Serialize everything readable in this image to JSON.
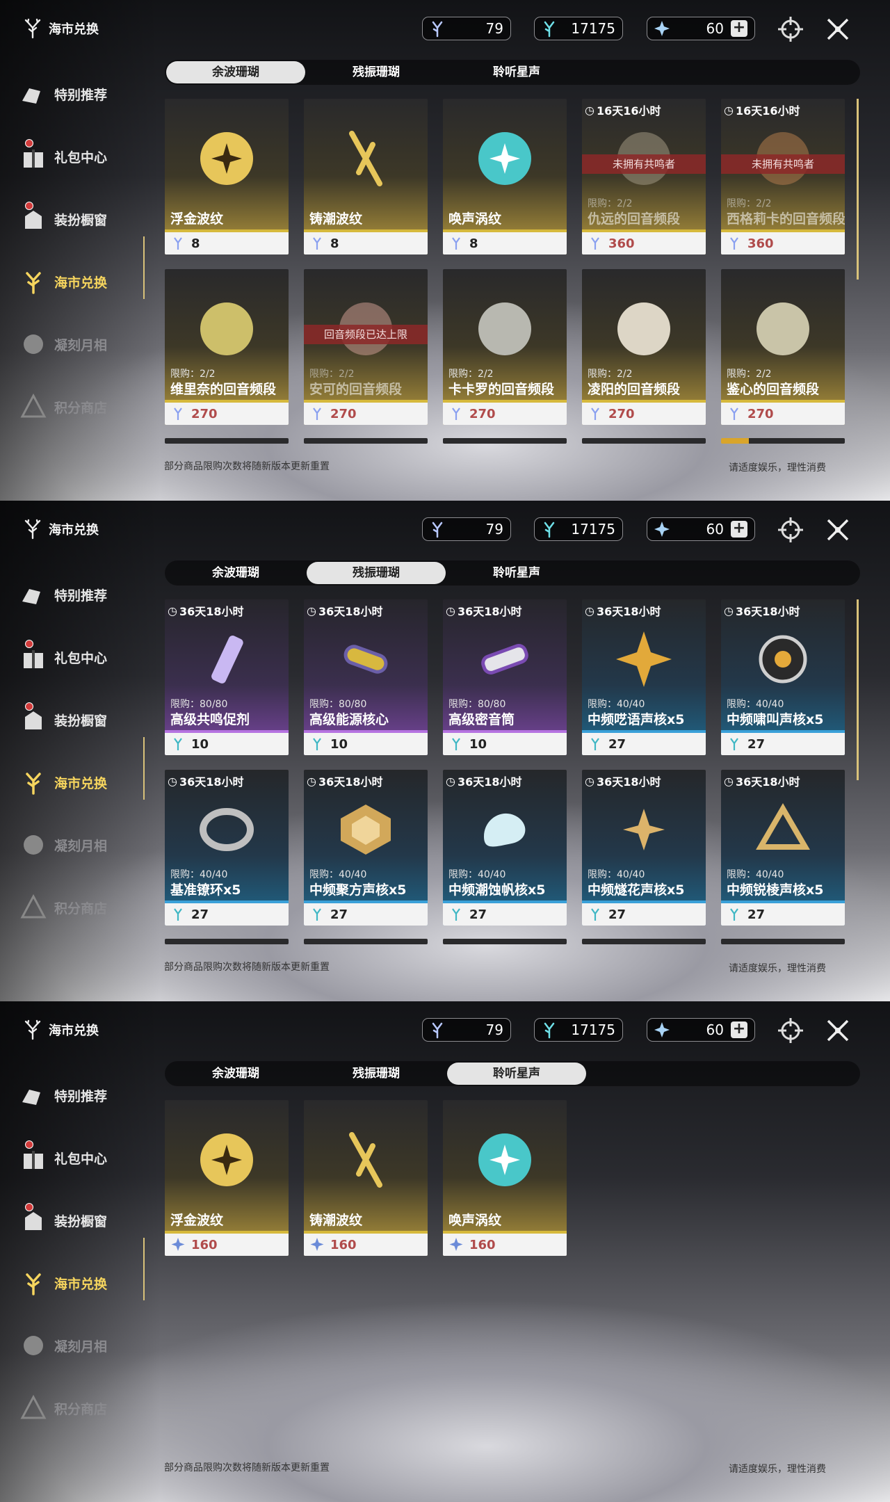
{
  "panels": [
    {
      "header": {
        "title": "海市兑换",
        "res1": "79",
        "res2": "17175",
        "res3": "60"
      },
      "sidebar": [
        {
          "label": "特别推荐"
        },
        {
          "label": "礼包中心"
        },
        {
          "label": "装扮橱窗"
        },
        {
          "label": "海市兑换"
        },
        {
          "label": "凝刻月相"
        },
        {
          "label": "积分商店"
        }
      ],
      "tabs": [
        {
          "label": "余波珊瑚"
        },
        {
          "label": "残振珊瑚"
        },
        {
          "label": "聆听星声"
        }
      ],
      "cards": [
        {
          "name": "浮金波纹",
          "price": "8"
        },
        {
          "name": "铸潮波纹",
          "price": "8"
        },
        {
          "name": "唤声涡纹",
          "price": "8"
        },
        {
          "timer": "16天16小时",
          "banner": "未拥有共鸣者",
          "limit": "限购：2/2",
          "name": "仇远的回音频段",
          "price": "360"
        },
        {
          "timer": "16天16小时",
          "banner": "未拥有共鸣者",
          "limit": "限购：2/2",
          "name": "西格莉卡的回音频段",
          "price": "360"
        },
        {
          "limit": "限购：2/2",
          "name": "维里奈的回音频段",
          "price": "270"
        },
        {
          "banner": "回音频段已达上限",
          "limit": "限购：2/2",
          "name": "安可的回音频段",
          "price": "270"
        },
        {
          "limit": "限购：2/2",
          "name": "卡卡罗的回音频段",
          "price": "270"
        },
        {
          "limit": "限购：2/2",
          "name": "凌阳的回音频段",
          "price": "270"
        },
        {
          "limit": "限购：2/2",
          "name": "鉴心的回音频段",
          "price": "270"
        }
      ],
      "note_left": "部分商品限购次数将随新版本更新重置",
      "note_right": "请适度娱乐，理性消费"
    },
    {
      "header": {
        "title": "海市兑换",
        "res1": "79",
        "res2": "17175",
        "res3": "60"
      },
      "sidebar": [
        {
          "label": "特别推荐"
        },
        {
          "label": "礼包中心"
        },
        {
          "label": "装扮橱窗"
        },
        {
          "label": "海市兑换"
        },
        {
          "label": "凝刻月相"
        },
        {
          "label": "积分商店"
        }
      ],
      "tabs": [
        {
          "label": "余波珊瑚"
        },
        {
          "label": "残振珊瑚"
        },
        {
          "label": "聆听星声"
        }
      ],
      "cards": [
        {
          "timer": "36天18小时",
          "limit": "限购：80/80",
          "name": "高级共鸣促剂",
          "price": "10"
        },
        {
          "timer": "36天18小时",
          "limit": "限购：80/80",
          "name": "高级能源核心",
          "price": "10"
        },
        {
          "timer": "36天18小时",
          "limit": "限购：80/80",
          "name": "高级密音筒",
          "price": "10"
        },
        {
          "timer": "36天18小时",
          "limit": "限购：40/40",
          "name": "中频呓语声核x5",
          "price": "27"
        },
        {
          "timer": "36天18小时",
          "limit": "限购：40/40",
          "name": "中频啸叫声核x5",
          "price": "27"
        },
        {
          "timer": "36天18小时",
          "limit": "限购：40/40",
          "name": "基准镣环x5",
          "price": "27"
        },
        {
          "timer": "36天18小时",
          "limit": "限购：40/40",
          "name": "中频聚方声核x5",
          "price": "27"
        },
        {
          "timer": "36天18小时",
          "limit": "限购：40/40",
          "name": "中频潮蚀帆核x5",
          "price": "27"
        },
        {
          "timer": "36天18小时",
          "limit": "限购：40/40",
          "name": "中频燧花声核x5",
          "price": "27"
        },
        {
          "timer": "36天18小时",
          "limit": "限购：40/40",
          "name": "中频锐棱声核x5",
          "price": "27"
        }
      ],
      "note_left": "部分商品限购次数将随新版本更新重置",
      "note_right": "请适度娱乐，理性消费"
    },
    {
      "header": {
        "title": "海市兑换",
        "res1": "79",
        "res2": "17175",
        "res3": "60"
      },
      "sidebar": [
        {
          "label": "特别推荐"
        },
        {
          "label": "礼包中心"
        },
        {
          "label": "装扮橱窗"
        },
        {
          "label": "海市兑换"
        },
        {
          "label": "凝刻月相"
        },
        {
          "label": "积分商店"
        }
      ],
      "tabs": [
        {
          "label": "余波珊瑚"
        },
        {
          "label": "残振珊瑚"
        },
        {
          "label": "聆听星声"
        }
      ],
      "cards": [
        {
          "name": "浮金波纹",
          "price": "160"
        },
        {
          "name": "铸潮波纹",
          "price": "160"
        },
        {
          "name": "唤声涡纹",
          "price": "160"
        }
      ],
      "note_left": "部分商品限购次数将随新版本更新重置",
      "note_right": "请适度娱乐，理性消费"
    }
  ]
}
